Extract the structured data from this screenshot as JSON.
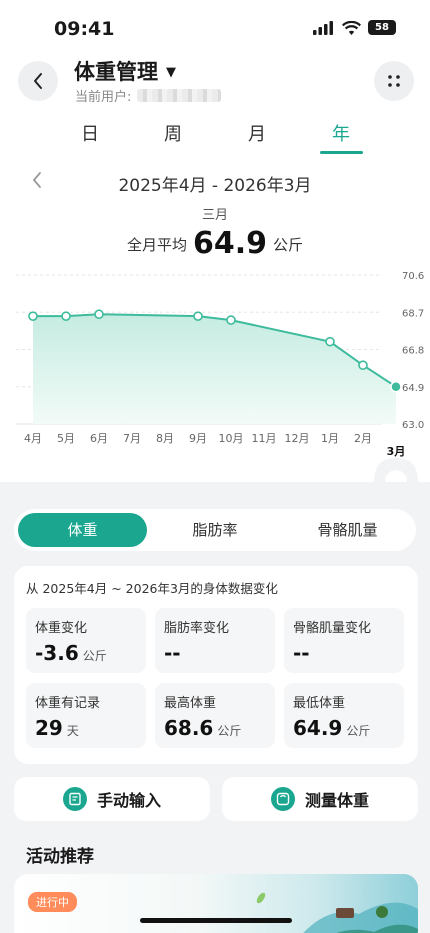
{
  "status": {
    "time": "09:41",
    "battery": "58"
  },
  "header": {
    "title": "体重管理",
    "user_label": "当前用户:"
  },
  "tabs": [
    {
      "label": "日"
    },
    {
      "label": "周"
    },
    {
      "label": "月"
    },
    {
      "label": "年"
    }
  ],
  "active_tab": "年",
  "period": {
    "range": "2025年4月 - 2026年3月",
    "month": "三月",
    "avg_label": "全月平均",
    "avg_value": "64.9",
    "avg_unit": "公斤"
  },
  "chart_data": {
    "type": "line",
    "categories": [
      "4月",
      "5月",
      "6月",
      "7月",
      "8月",
      "9月",
      "10月",
      "11月",
      "12月",
      "1月",
      "2月",
      "3月"
    ],
    "values": [
      68.5,
      68.5,
      68.6,
      null,
      null,
      68.5,
      68.3,
      null,
      null,
      67.2,
      66.0,
      64.9
    ],
    "yticks": [
      "70.6",
      "68.7",
      "66.8",
      "64.9",
      "63.0"
    ],
    "ylim": [
      63.0,
      70.6
    ],
    "selected": "3月",
    "line_color": "#3dbb9c"
  },
  "segments": [
    {
      "label": "体重"
    },
    {
      "label": "脂肪率"
    },
    {
      "label": "骨骼肌量"
    }
  ],
  "summary": {
    "title": "从 2025年4月 ~ 2026年3月的身体数据变化",
    "cells": [
      {
        "label": "体重变化",
        "value": "-3.6",
        "unit": "公斤"
      },
      {
        "label": "脂肪率变化",
        "value": "--",
        "unit": ""
      },
      {
        "label": "骨骼肌量变化",
        "value": "--",
        "unit": ""
      },
      {
        "label": "体重有记录",
        "value": "29",
        "unit": "天"
      },
      {
        "label": "最高体重",
        "value": "68.6",
        "unit": "公斤"
      },
      {
        "label": "最低体重",
        "value": "64.9",
        "unit": "公斤"
      }
    ]
  },
  "actions": {
    "manual": "手动输入",
    "measure": "测量体重"
  },
  "activity": {
    "title": "活动推荐",
    "badge": "进行中"
  },
  "colors": {
    "accent": "#1aa68f",
    "badge": "#ff8c5a"
  }
}
